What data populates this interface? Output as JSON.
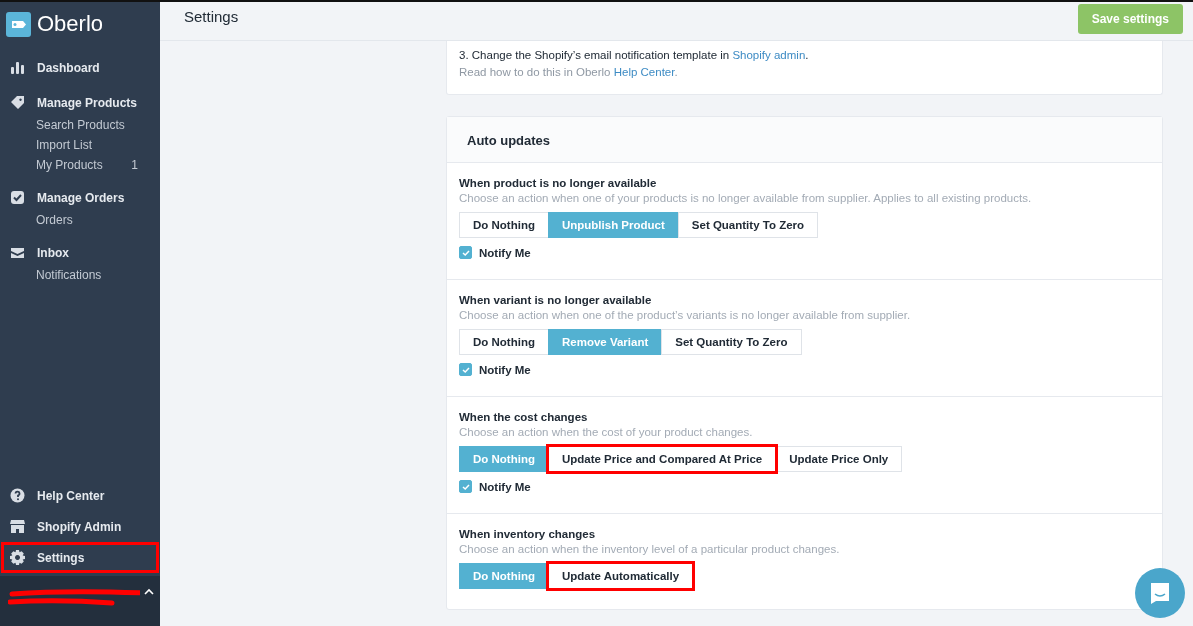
{
  "brand": "Oberlo",
  "nav": [
    {
      "label": "Dashboard",
      "selected": false
    },
    {
      "label": "Manage Products",
      "selected": false,
      "children": [
        {
          "label": "Search Products"
        },
        {
          "label": "Import List"
        },
        {
          "label": "My Products",
          "count": "1"
        }
      ]
    },
    {
      "label": "Manage Orders",
      "selected": false,
      "children": [
        {
          "label": "Orders"
        }
      ]
    },
    {
      "label": "Inbox",
      "selected": false,
      "children": [
        {
          "label": "Notifications"
        }
      ]
    }
  ],
  "bottom_nav": [
    {
      "label": "Help Center",
      "highlighted": false
    },
    {
      "label": "Shopify Admin",
      "highlighted": false
    },
    {
      "label": "Settings",
      "highlighted": true
    }
  ],
  "header": {
    "title": "Settings",
    "save_button": "Save settings"
  },
  "notice": {
    "step": "3. Change the Shopify’s email notification template in ",
    "step_link": "Shopify admin",
    "step_end": ".",
    "help": "Read how to do this in Oberlo ",
    "help_link": "Help Center",
    "help_end": "."
  },
  "auto_updates": {
    "title": "Auto updates",
    "sections": [
      {
        "title": "When product is no longer available",
        "description": "Choose an action when one of your products is no longer available from supplier. Applies to all existing products.",
        "options": [
          {
            "label": "Do Nothing",
            "selected": false,
            "highlighted": false
          },
          {
            "label": "Unpublish Product",
            "selected": true,
            "highlighted": false
          },
          {
            "label": "Set Quantity To Zero",
            "selected": false,
            "highlighted": false
          }
        ],
        "notify": {
          "label": "Notify Me",
          "checked": true
        }
      },
      {
        "title": "When variant is no longer available",
        "description": "Choose an action when one of the product’s variants is no longer available from supplier.",
        "options": [
          {
            "label": "Do Nothing",
            "selected": false,
            "highlighted": false
          },
          {
            "label": "Remove Variant",
            "selected": true,
            "highlighted": false
          },
          {
            "label": "Set Quantity To Zero",
            "selected": false,
            "highlighted": false
          }
        ],
        "notify": {
          "label": "Notify Me",
          "checked": true
        }
      },
      {
        "title": "When the cost changes",
        "description": "Choose an action when the cost of your product changes.",
        "options": [
          {
            "label": "Do Nothing",
            "selected": true,
            "highlighted": false
          },
          {
            "label": "Update Price and Compared At Price",
            "selected": false,
            "highlighted": true
          },
          {
            "label": "Update Price Only",
            "selected": false,
            "highlighted": false
          }
        ],
        "notify": {
          "label": "Notify Me",
          "checked": true
        }
      },
      {
        "title": "When inventory changes",
        "description": "Choose an action when the inventory level of a particular product changes.",
        "options": [
          {
            "label": "Do Nothing",
            "selected": true,
            "highlighted": false
          },
          {
            "label": "Update Automatically",
            "selected": false,
            "highlighted": true
          }
        ]
      }
    ]
  }
}
